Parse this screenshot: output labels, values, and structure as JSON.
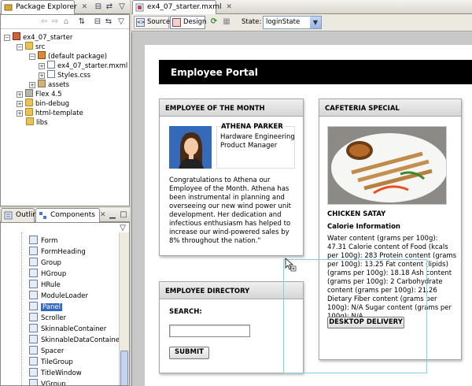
{
  "package_explorer": {
    "tab_label": "Package Explorer",
    "tree": [
      {
        "label": "ex4_07_starter",
        "icon": "project-icon",
        "expander": "−"
      },
      {
        "label": "src",
        "icon": "source-folder-icon",
        "expander": "−"
      },
      {
        "label": "(default package)",
        "icon": "package-icon",
        "expander": "−"
      },
      {
        "label": "ex4_07_starter.mxml",
        "icon": "mxml-file-icon",
        "expander": "+"
      },
      {
        "label": "Styles.css",
        "icon": "css-file-icon",
        "expander": "+"
      },
      {
        "label": "assets",
        "icon": "package-icon",
        "expander": "+"
      },
      {
        "label": "Flex 4.5",
        "icon": "library-icon",
        "expander": "+"
      },
      {
        "label": "bin-debug",
        "icon": "folder-icon",
        "expander": "+"
      },
      {
        "label": "html-template",
        "icon": "folder-icon",
        "expander": "+"
      },
      {
        "label": "libs",
        "icon": "folder-icon",
        "expander": ""
      }
    ]
  },
  "components_view": {
    "outline_tab": "Outline",
    "components_tab": "Components",
    "items": [
      "Form",
      "FormHeading",
      "Group",
      "HGroup",
      "HRule",
      "ModuleLoader",
      "Panel",
      "Scroller",
      "SkinnableContainer",
      "SkinnableDataContainer",
      "Spacer",
      "TileGroup",
      "TitleWindow",
      "VGroup"
    ],
    "selected": "Panel"
  },
  "editor": {
    "tab_label": "ex4_07_starter.mxml",
    "source_label": "Source",
    "design_label": "Design",
    "state_label": "State:",
    "state_value": "loginState"
  },
  "app": {
    "header_title": "Employee Portal",
    "employee_panel": {
      "title": "EMPLOYEE OF THE MONTH",
      "name": "ATHENA PARKER",
      "role": "Hardware Engineering Product Manager",
      "body": "Congratulations to Athena our Employee of the Month. Athena has been instrumental in planning and overseeing our new wind power unit development. Her dedication and infectious enthusiasm has helped to increase our wind-powered sales by 8% throughout the nation.\""
    },
    "cafeteria_panel": {
      "title": "CAFETERIA SPECIAL",
      "dish": "CHICKEN SATAY",
      "subhead": "Calorie Information",
      "nutrition": "Water content (grams per 100g): 47.31 Calorie content of Food (kcals per 100g): 283 Protein content (grams per 100g): 13.25 Fat content (lipids) (grams per 100g): 18.18 Ash content (grams per 100g): 2 Carbohydrate content (grams per 100g): 21.26 Dietary Fiber content (grams per 100g): N/A Sugar content (grams per 100g): N/A",
      "button": "DESKTOP DELIVERY"
    },
    "directory_panel": {
      "title": "EMPLOYEE DIRECTORY",
      "search_label": "SEARCH:",
      "search_value": "",
      "submit": "SUBMIT"
    }
  },
  "colors": {
    "header_bg": "#000000",
    "canvas_bg": "#ffffff",
    "workspace_bg": "#c8c8c8",
    "selection": "#316ac5",
    "guide": "#7fd0e0"
  }
}
